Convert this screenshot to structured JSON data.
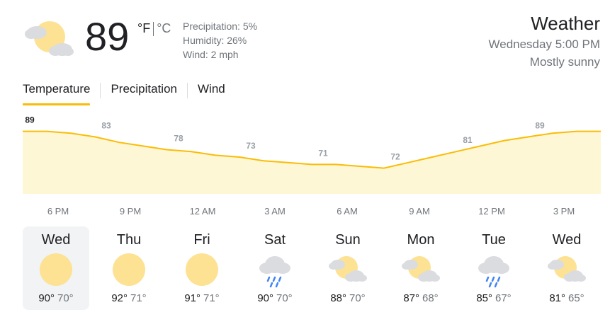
{
  "current": {
    "icon": "partly-sunny-icon",
    "temperature": "89",
    "unit_f": "°F",
    "unit_c": "°C",
    "precipitation": "Precipitation: 5%",
    "humidity": "Humidity: 26%",
    "wind": "Wind: 2 mph"
  },
  "header": {
    "title": "Weather",
    "datetime": "Wednesday 5:00 PM",
    "condition": "Mostly sunny"
  },
  "tabs": [
    {
      "label": "Temperature",
      "active": true
    },
    {
      "label": "Precipitation",
      "active": false
    },
    {
      "label": "Wind",
      "active": false
    }
  ],
  "colors": {
    "accent": "#fbbc04",
    "fill": "#fef7d6",
    "sun": "#fde293",
    "cloud": "#dadce0",
    "rain": "#4285f4"
  },
  "chart_data": {
    "type": "area",
    "x": [
      "5 PM",
      "6 PM",
      "7 PM",
      "8 PM",
      "9 PM",
      "10 PM",
      "11 PM",
      "12 AM",
      "1 AM",
      "2 AM",
      "3 AM",
      "4 AM",
      "5 AM",
      "6 AM",
      "7 AM",
      "8 AM",
      "9 AM",
      "10 AM",
      "11 AM",
      "12 PM",
      "1 PM",
      "2 PM",
      "3 PM",
      "4 PM",
      "5 PM"
    ],
    "values": [
      89,
      89,
      88,
      86,
      83,
      81,
      79,
      78,
      76,
      75,
      73,
      72,
      71,
      71,
      70,
      69,
      72,
      75,
      78,
      81,
      84,
      86,
      88,
      89,
      89
    ],
    "labels": [
      {
        "x": "5 PM",
        "value": "89"
      },
      {
        "x": "8 PM",
        "value": "83"
      },
      {
        "x": "11 PM",
        "value": "78"
      },
      {
        "x": "2 AM",
        "value": "73"
      },
      {
        "x": "5 AM",
        "value": "71"
      },
      {
        "x": "8 AM",
        "value": "72"
      },
      {
        "x": "11 AM",
        "value": "81"
      },
      {
        "x": "2 PM",
        "value": "89"
      }
    ],
    "tick_labels": [
      "6 PM",
      "9 PM",
      "12 AM",
      "3 AM",
      "6 AM",
      "9 AM",
      "12 PM",
      "3 PM"
    ],
    "ylim": [
      55,
      95
    ],
    "grid": false
  },
  "days": [
    {
      "name": "Wed",
      "icon": "sunny-icon",
      "high": "90°",
      "low": "70°",
      "selected": true
    },
    {
      "name": "Thu",
      "icon": "sunny-icon",
      "high": "92°",
      "low": "71°",
      "selected": false
    },
    {
      "name": "Fri",
      "icon": "sunny-icon",
      "high": "91°",
      "low": "71°",
      "selected": false
    },
    {
      "name": "Sat",
      "icon": "showers-icon",
      "high": "90°",
      "low": "70°",
      "selected": false
    },
    {
      "name": "Sun",
      "icon": "partly-sunny-icon",
      "high": "88°",
      "low": "70°",
      "selected": false
    },
    {
      "name": "Mon",
      "icon": "partly-sunny-icon",
      "high": "87°",
      "low": "68°",
      "selected": false
    },
    {
      "name": "Tue",
      "icon": "showers-icon",
      "high": "85°",
      "low": "67°",
      "selected": false
    },
    {
      "name": "Wed",
      "icon": "partly-sunny-icon",
      "high": "81°",
      "low": "65°",
      "selected": false
    }
  ]
}
